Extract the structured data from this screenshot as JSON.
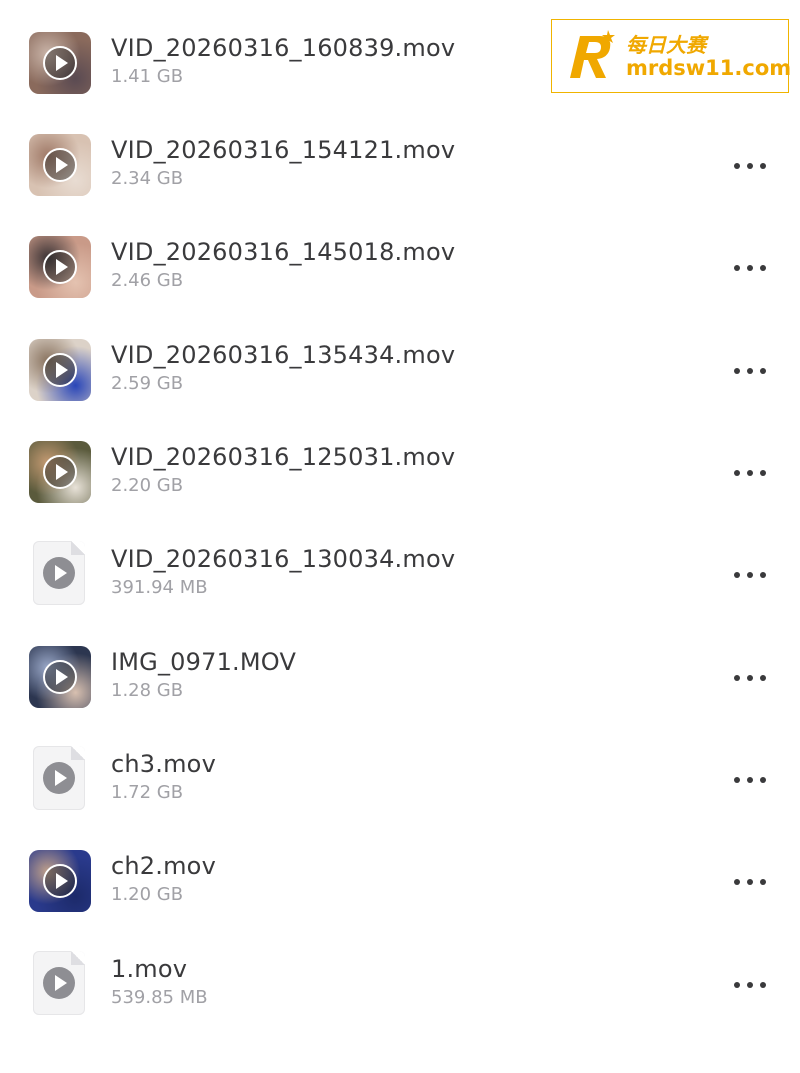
{
  "files": [
    {
      "name": "VID_20260316_160839.mov",
      "size": "1.41 GB",
      "thumb": "photo",
      "colors": [
        "#8a6a5c",
        "#c9b4a8",
        "#5a4a52"
      ]
    },
    {
      "name": "VID_20260316_154121.mov",
      "size": "2.34 GB",
      "thumb": "photo",
      "colors": [
        "#d8c2b2",
        "#a07a68",
        "#e8dcd2"
      ]
    },
    {
      "name": "VID_20260316_145018.mov",
      "size": "2.46 GB",
      "thumb": "photo",
      "colors": [
        "#c99a88",
        "#3c3436",
        "#e4c2b0"
      ]
    },
    {
      "name": "VID_20260316_135434.mov",
      "size": "2.59 GB",
      "thumb": "photo",
      "colors": [
        "#dcd2c8",
        "#8a7460",
        "#2a46b8"
      ]
    },
    {
      "name": "VID_20260316_125031.mov",
      "size": "2.20 GB",
      "thumb": "photo",
      "colors": [
        "#5a5a3c",
        "#c49a72",
        "#e8e2d8"
      ]
    },
    {
      "name": "VID_20260316_130034.mov",
      "size": "391.94 MB",
      "thumb": "file",
      "colors": []
    },
    {
      "name": "IMG_0971.MOV",
      "size": "1.28 GB",
      "thumb": "photo",
      "colors": [
        "#2c3650",
        "#9aa8c8",
        "#d8c0b0"
      ]
    },
    {
      "name": "ch3.mov",
      "size": "1.72 GB",
      "thumb": "file",
      "colors": []
    },
    {
      "name": "ch2.mov",
      "size": "1.20 GB",
      "thumb": "photo",
      "colors": [
        "#2a3a8c",
        "#c0a08a",
        "#1c2a6a"
      ]
    },
    {
      "name": "1.mov",
      "size": "539.85 MB",
      "thumb": "file",
      "colors": []
    }
  ],
  "icons": {
    "play": "play-icon",
    "more": "ellipsis-icon",
    "file": "video-file-icon"
  },
  "watermark": {
    "title": "每日大赛",
    "url": "mrdsw11.com",
    "color": "#f0a800"
  }
}
